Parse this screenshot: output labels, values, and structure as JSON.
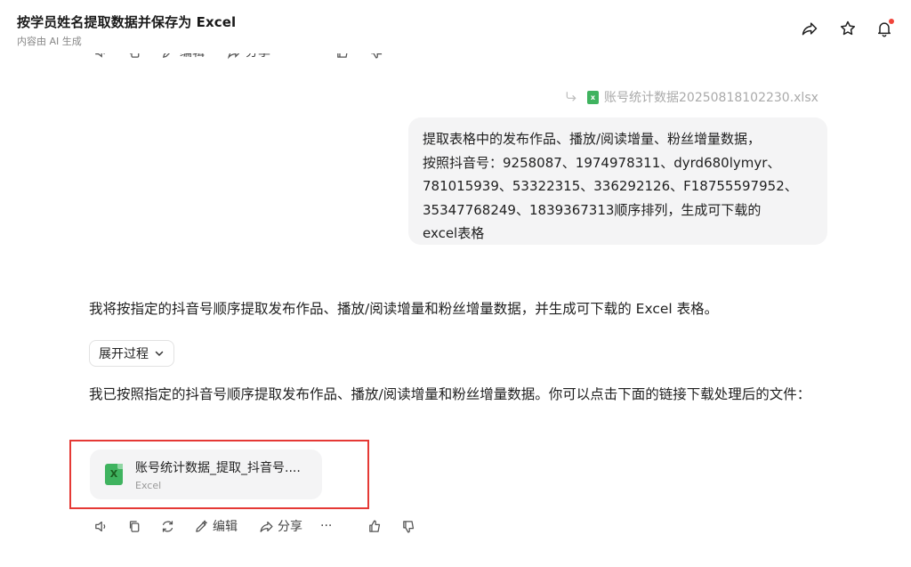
{
  "header": {
    "title": "按学员姓名提取数据并保存为 Excel",
    "subtitle": "内容由 AI 生成"
  },
  "top_toolbar": {
    "edit_label": "编辑",
    "share_label": "分享",
    "more_label": "···"
  },
  "user_message": {
    "attachment_name": "账号统计数据20250818102230.xlsx",
    "lines": [
      "提取表格中的发布作品、播放/阅读增量、粉丝增量数据，",
      "按照抖音号：9258087、1974978311、dyrd680lymyr、",
      "781015939、53322315、336292126、F18755597952、",
      "35347768249、1839367313顺序排列，生成可下载的",
      "excel表格"
    ]
  },
  "assistant": {
    "intro": "我将按指定的抖音号顺序提取发布作品、播放/阅读增量和粉丝增量数据，并生成可下载的 Excel 表格。",
    "expand_label": "展开过程",
    "result_text": "我已按照指定的抖音号顺序提取发布作品、播放/阅读增量和粉丝增量数据。你可以点击下面的链接下载处理后的文件：",
    "file": {
      "name": "账号统计数据_提取_抖音号....",
      "type": "Excel",
      "icon_letter": "X"
    }
  },
  "bottom_toolbar": {
    "edit_label": "编辑",
    "share_label": "分享",
    "more_label": "···"
  },
  "colors": {
    "highlight_border": "#e53935",
    "excel_green": "#3fb35f",
    "notification_dot": "#f0443a"
  }
}
